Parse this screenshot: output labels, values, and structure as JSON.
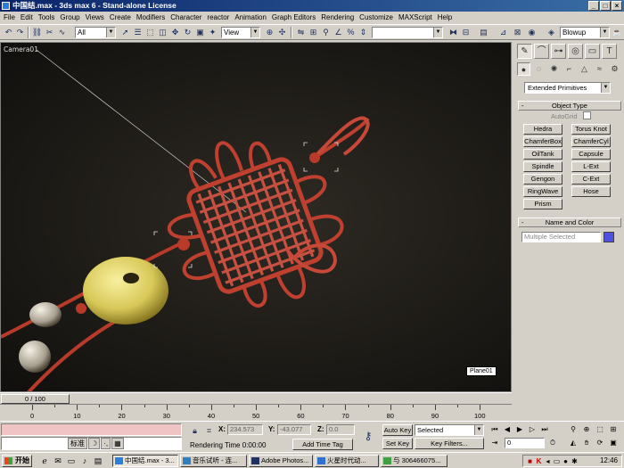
{
  "window": {
    "title": "中国结.max - 3ds max 6 - Stand-alone License",
    "minimize": "_",
    "maximize": "□",
    "close": "×"
  },
  "menu": [
    "File",
    "Edit",
    "Tools",
    "Group",
    "Views",
    "Create",
    "Modifiers",
    "Character",
    "reactor",
    "Animation",
    "Graph Editors",
    "Rendering",
    "Customize",
    "MAXScript",
    "Help"
  ],
  "toolbar": {
    "selection_filter": "All",
    "ref_coord": "View",
    "named_selection": "",
    "render_type": "Blowup"
  },
  "viewport": {
    "label": "Camera01",
    "object_tag": "Plane01"
  },
  "command_panel": {
    "category": "Extended Primitives",
    "object_type_title": "Object Type",
    "autogrid_label": "AutoGrid",
    "objects": [
      "Hedra",
      "Torus Knot",
      "ChamferBox",
      "ChamferCyl",
      "OilTank",
      "Capsule",
      "Spindle",
      "L-Ext",
      "Gengon",
      "C-Ext",
      "RingWave",
      "Hose",
      "Prism"
    ],
    "name_color_title": "Name and Color",
    "name_placeholder": "Multiple Selected",
    "swatch_color": "#5050e0"
  },
  "timeline": {
    "slider_label": "0 / 100",
    "ticks": [
      "0",
      "10",
      "20",
      "30",
      "40",
      "50",
      "60",
      "70",
      "80",
      "90",
      "100"
    ]
  },
  "status": {
    "x_label": "X:",
    "x_value": "234.573",
    "y_label": "Y:",
    "y_value": "-43.077",
    "z_label": "Z:",
    "z_value": "0.0",
    "rendering_time": "Rendering Time  0:00:00",
    "add_time_tag": "Add Time Tag",
    "auto_key": "Auto Key",
    "set_key": "Set Key",
    "key_mode": "Selected",
    "key_filters": "Key Filters...",
    "current_frame": "0",
    "ime": [
      "标准",
      "☽",
      "·,",
      "▦"
    ]
  },
  "taskbar": {
    "start": "开始",
    "tasks": [
      "中国结.max - 3...",
      "音乐试听 - 连...",
      "Adobe Photos...",
      "火星时代动...",
      "与 306466075..."
    ],
    "clock": "12:46"
  }
}
